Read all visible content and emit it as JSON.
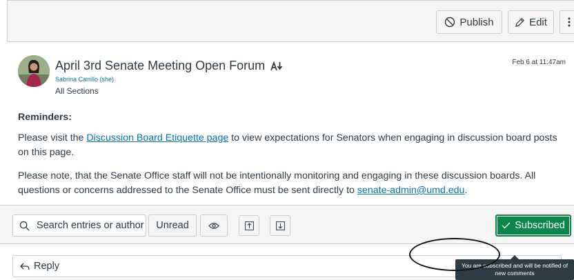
{
  "header": {
    "publish_label": "Publish",
    "edit_label": "Edit",
    "publish_icon": "no-entry-icon",
    "edit_icon": "pencil-icon",
    "more_icon": "kebab-icon"
  },
  "topic": {
    "title": "April 3rd Senate Meeting Open Forum",
    "author": "Sabrina Carrillo (she)",
    "sections": "All Sections",
    "date": "Feb 6 at 11:47am",
    "reminders_heading": "Reminders:",
    "para1_before": "Please visit the ",
    "para1_link": "Discussion Board Etiquette page",
    "para1_after": " to view expectations for Senators when engaging in discussion board posts on this page.",
    "para2_before": "Please note, that the Senate Office staff will not be intentionally monitoring and engaging in these discussion boards. All questions or concerns addressed to the Senate Office must be sent directly to ",
    "para2_link": "senate-admin@umd.edu",
    "para2_after": "."
  },
  "toolbar": {
    "search_placeholder": "Search entries or author",
    "unread_label": "Unread",
    "subscribed_label": "Subscribed",
    "tooltip_text": "You are subscribed and will be notified of new comments"
  },
  "reply": {
    "label": "Reply"
  },
  "colors": {
    "subscribed_bg": "#0b874b",
    "link": "#0374b5",
    "text": "#2d3b45",
    "tooltip_bg": "#2d3b45"
  }
}
